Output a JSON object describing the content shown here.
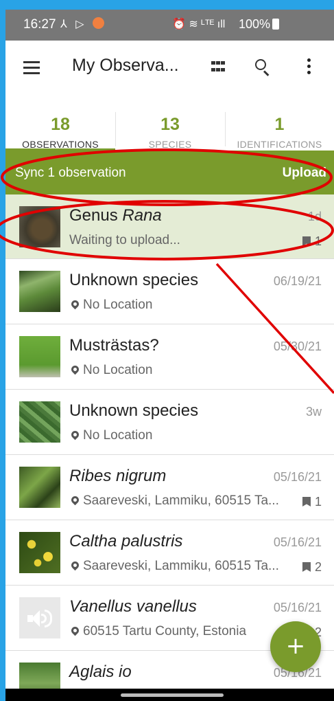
{
  "status_bar": {
    "time": "16:27",
    "left_icons": "⅄ ▷",
    "right_icons": "⏰ ≋ ᴸᵀᴱ ıll",
    "battery": "100%"
  },
  "header": {
    "title": "My Observa...",
    "icons": [
      "menu-icon",
      "grid-icon",
      "search-icon",
      "more-vert-icon"
    ]
  },
  "tabs": [
    {
      "count": "18",
      "label": "OBSERVATIONS",
      "active": true
    },
    {
      "count": "13",
      "label": "SPECIES",
      "active": false
    },
    {
      "count": "1",
      "label": "IDENTIFICATIONS",
      "active": false
    }
  ],
  "sync": {
    "text": "Sync 1 observation",
    "action": "Upload"
  },
  "observations": [
    {
      "name_prefix": "Genus ",
      "name_italic": "Rana",
      "subtitle": "Waiting to upload...",
      "date": "1d",
      "ids": "1"
    },
    {
      "name": "Unknown species",
      "location": "No Location",
      "date": "06/19/21",
      "ids": ""
    },
    {
      "name": "Musträstas?",
      "location": "No Location",
      "date": "05/30/21",
      "ids": ""
    },
    {
      "name": "Unknown species",
      "location": "No Location",
      "date": "3w",
      "ids": ""
    },
    {
      "name": "Ribes nigrum",
      "location": "Saareveski, Lammiku, 60515 Ta...",
      "date": "05/16/21",
      "ids": "1"
    },
    {
      "name": "Caltha palustris",
      "location": "Saareveski, Lammiku, 60515 Ta...",
      "date": "05/16/21",
      "ids": "2"
    },
    {
      "name": "Vanellus vanellus",
      "location": "60515 Tartu County, Estonia",
      "date": "05/16/21",
      "ids": "2"
    },
    {
      "name": "Aglais io",
      "location": "",
      "date": "05/16/21",
      "ids": ""
    }
  ],
  "fab": {
    "label": "+"
  },
  "colors": {
    "accent": "#7a9b2c",
    "status_bar": "#777777",
    "pending_row": "#e4ecd5",
    "annotation_red": "#e00000",
    "background": "#29a3e6"
  }
}
